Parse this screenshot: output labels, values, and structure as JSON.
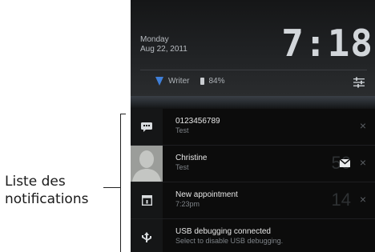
{
  "callout": {
    "line1": "Liste des",
    "line2": "notifications"
  },
  "header": {
    "day": "Monday",
    "date": "Aug 22, 2011",
    "clock": "7:18",
    "network": "Writer",
    "battery": "84%"
  },
  "notifications": [
    {
      "icon": "message-icon",
      "title": "0123456789",
      "subtitle": "Test",
      "close": "×"
    },
    {
      "icon": "contact-avatar",
      "title": "Christine",
      "subtitle": "Test",
      "count": "50",
      "close": "×"
    },
    {
      "icon": "calendar-icon",
      "title": "New appointment",
      "subtitle": "7:23pm",
      "count": "14",
      "close": "×"
    },
    {
      "icon": "usb-icon",
      "title": "USB debugging connected",
      "subtitle": "Select to disable USB debugging."
    }
  ],
  "colors": {
    "wifi": "#3f7fd8",
    "background": "#0c0c0c"
  }
}
